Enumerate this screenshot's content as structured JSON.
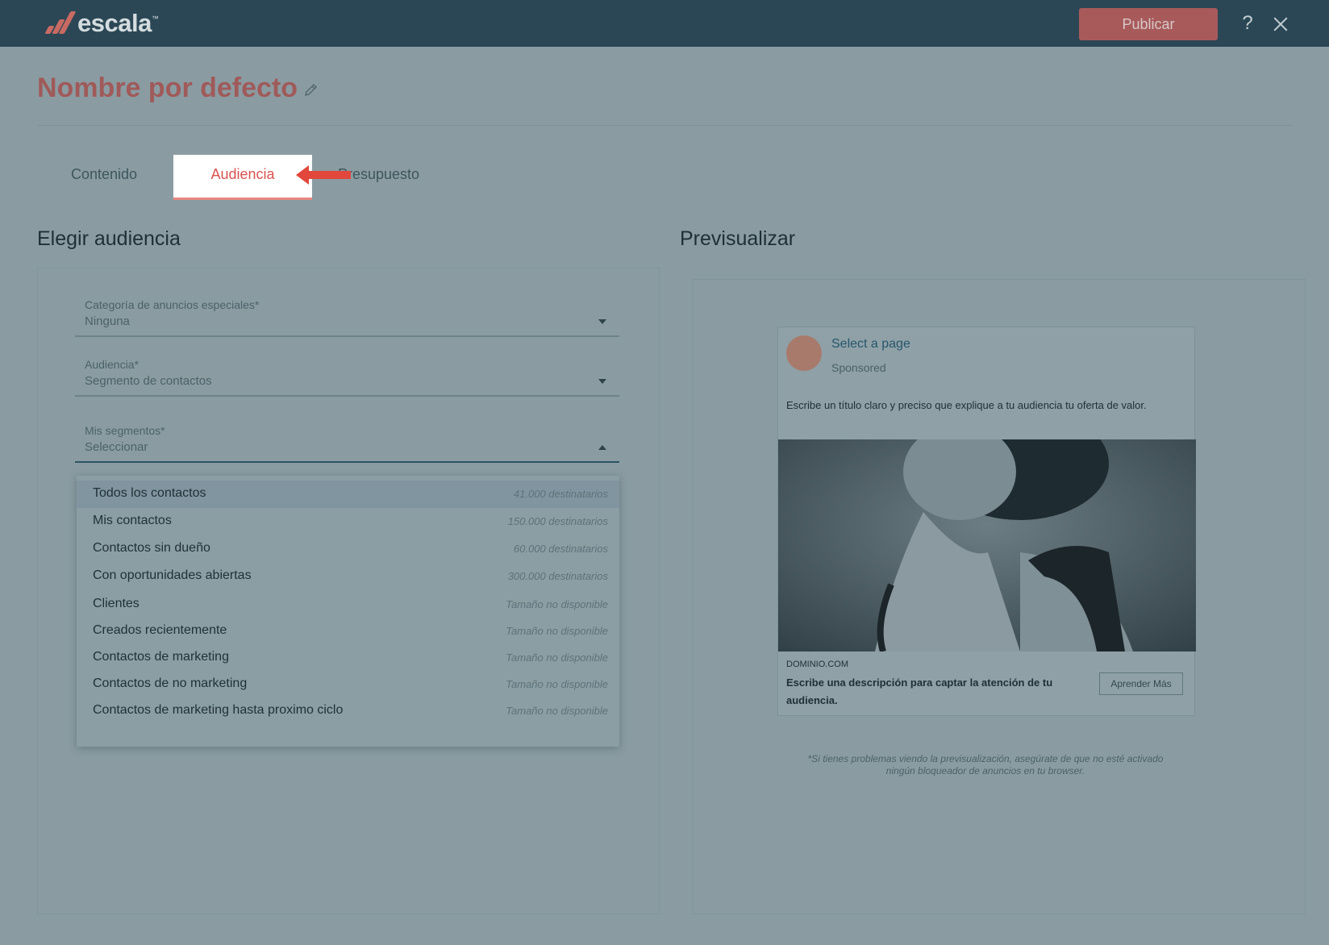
{
  "header": {
    "logo_text": "escala",
    "logo_tm": "™",
    "publish_label": "Publicar",
    "help_label": "?"
  },
  "page": {
    "title": "Nombre por defecto"
  },
  "tabs": [
    {
      "label": "Contenido"
    },
    {
      "label": "Audiencia",
      "active": true
    },
    {
      "label": "Presupuesto"
    }
  ],
  "left": {
    "section_title": "Elegir audiencia",
    "fields": {
      "category": {
        "label": "Categoría de anuncios especiales*",
        "value": "Ninguna"
      },
      "audience": {
        "label": "Audiencia*",
        "value": "Segmento de contactos"
      },
      "segments": {
        "label": "Mis segmentos*",
        "value": "Seleccionar"
      }
    },
    "dropdown_items": [
      {
        "name": "Todos los contactos",
        "count": "41.000 destinatarios"
      },
      {
        "name": "Mis contactos",
        "count": "150.000 destinatarios"
      },
      {
        "name": "Contactos sin dueño",
        "count": "60.000 destinatarios"
      },
      {
        "name": "Con oportunidades abiertas",
        "count": "300.000 destinatarios"
      },
      {
        "name": "Clientes",
        "count": "Tamaño no disponible"
      },
      {
        "name": "Creados recientemente",
        "count": "Tamaño no disponible"
      },
      {
        "name": "Contactos de marketing",
        "count": "Tamaño no disponible"
      },
      {
        "name": "Contactos de no marketing",
        "count": "Tamaño no disponible"
      },
      {
        "name": "Contactos de marketing hasta proximo ciclo",
        "count": "Tamaño no disponible"
      }
    ]
  },
  "right": {
    "section_title": "Previsualizar",
    "ad": {
      "page_name": "Select a page",
      "sponsored": "Sponsored",
      "headline": "Escribe un título claro y preciso que explique a tu audiencia tu oferta de valor.",
      "domain": "DOMINIO.COM",
      "description": "Escribe una descripción para captar la atención de tu audiencia.",
      "cta": "Aprender Más"
    },
    "note": "*Si tienes problemas viendo la previsualización, asegúrate de que no esté activado ningún bloqueador de anuncios en tu browser."
  },
  "colors": {
    "brand_accent": "#d9534f",
    "topbar": "#2b4755",
    "overlay_bg": "#8a9ca2"
  },
  "icons": [
    "escala-logo-icon",
    "question-icon",
    "close-icon",
    "pencil-icon",
    "arrow-left-icon",
    "caret-down-icon",
    "caret-up-icon"
  ]
}
